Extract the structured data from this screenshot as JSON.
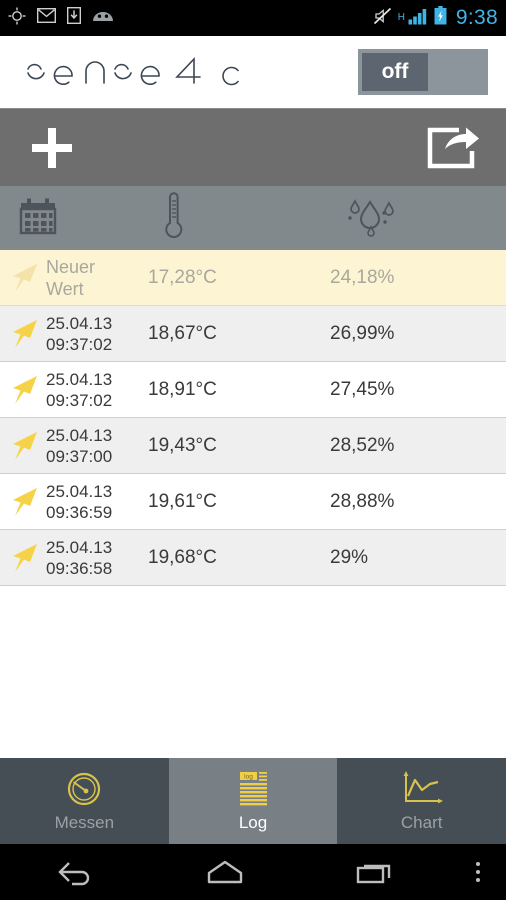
{
  "statusbar": {
    "time": "9:38",
    "network_type": "H",
    "icons": [
      "location-icon",
      "gmail-icon",
      "download-icon",
      "android-robot-icon",
      "mute-icon",
      "signal-bars-icon",
      "battery-charging-icon"
    ],
    "accent_color": "#3fb4e5"
  },
  "header": {
    "logo_text": "sense4c",
    "toggle": {
      "label": "off",
      "state": "off",
      "track_color": "#8d959c",
      "thumb_color": "#5d6670"
    }
  },
  "actionbar": {
    "add_label": "+",
    "add_name": "add-entry-button",
    "share_name": "share-export-button",
    "background": "#6e6e6e"
  },
  "columns": {
    "date_icon": "calendar-icon",
    "temperature_icon": "thermometer-icon",
    "humidity_icon": "humidity-droplets-icon",
    "background": "#82898d"
  },
  "log": {
    "rows": [
      {
        "status": "pending",
        "date": "Neuer",
        "time": "Wert",
        "temperature": "17,28°C",
        "humidity": "24,18%"
      },
      {
        "status": "logged",
        "date": "25.04.13",
        "time": "09:37:02",
        "temperature": "18,67°C",
        "humidity": "26,99%"
      },
      {
        "status": "logged",
        "date": "25.04.13",
        "time": "09:37:02",
        "temperature": "18,91°C",
        "humidity": "27,45%"
      },
      {
        "status": "logged",
        "date": "25.04.13",
        "time": "09:37:00",
        "temperature": "19,43°C",
        "humidity": "28,52%"
      },
      {
        "status": "logged",
        "date": "25.04.13",
        "time": "09:36:59",
        "temperature": "19,61°C",
        "humidity": "28,88%"
      },
      {
        "status": "logged",
        "date": "25.04.13",
        "time": "09:36:58",
        "temperature": "19,68°C",
        "humidity": "29%"
      }
    ],
    "arrow_color": "#f5d247",
    "arrow_color_pending": "#f3e3a8"
  },
  "tabs": [
    {
      "label": "Messen",
      "icon": "gauge-icon",
      "active": false
    },
    {
      "label": "Log",
      "icon": "log-document-icon",
      "active": true
    },
    {
      "label": "Chart",
      "icon": "line-chart-icon",
      "active": false
    }
  ],
  "navbar": {
    "back": "back-icon",
    "home": "home-icon",
    "recents": "recents-icon",
    "overflow": "overflow-menu-icon"
  }
}
